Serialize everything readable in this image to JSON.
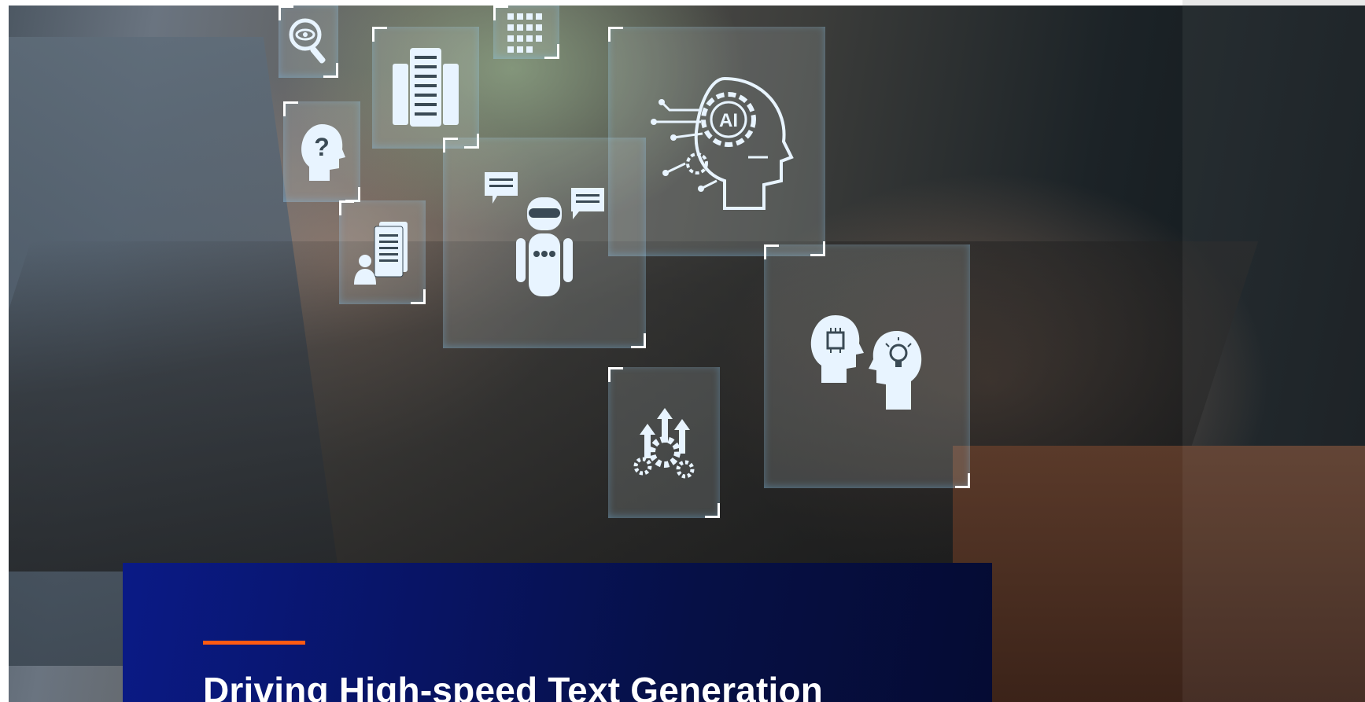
{
  "article": {
    "headline": "Driving High-speed Text Generation",
    "accent_color": "#ff5a12",
    "card_color": "#0a1a86"
  },
  "hero": {
    "icons": [
      "magnifier-eye-icon",
      "server-rack-icon",
      "building-icon",
      "ai-head-gear-icon",
      "question-head-icon",
      "document-user-icon",
      "chatbot-robot-icon",
      "gears-arrows-icon",
      "brain-heads-icon"
    ],
    "icon_labels": {
      "ai": "AI"
    }
  }
}
